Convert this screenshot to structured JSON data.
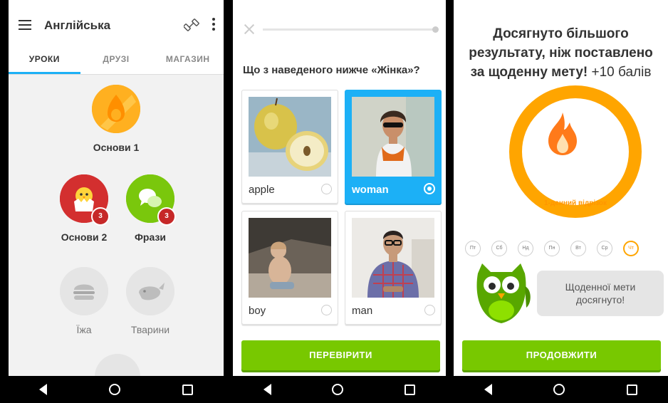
{
  "screen1": {
    "title": "Англійська",
    "tabs": [
      "УРОКИ",
      "ДРУЗІ",
      "МАГАЗИН"
    ],
    "skills": [
      {
        "name": "Основи 1"
      },
      {
        "name": "Основи 2",
        "badge": "3"
      },
      {
        "name": "Фрази",
        "badge": "3"
      },
      {
        "name": "Їжа"
      },
      {
        "name": "Тварини"
      }
    ]
  },
  "screen2": {
    "question": "Що з наведеного нижче «Жінка»?",
    "options": [
      "apple",
      "woman",
      "boy",
      "man"
    ],
    "selected": "woman",
    "check_button": "ПЕРЕВІРИТИ"
  },
  "screen3": {
    "title_line1": "Досягнуто більшого",
    "title_line2": "результату, ніж поставлено",
    "title_line3": "за щоденну мету!",
    "points": "+10 балів",
    "streak_label": "1-денний відрізок",
    "days": [
      "Пт",
      "Сб",
      "Нд",
      "Пн",
      "Вт",
      "Ср",
      "Чт"
    ],
    "owl_message": "Щоденної мети досягнуто!",
    "continue_button": "ПРОДОВЖИТИ"
  },
  "colors": {
    "blue": "#1cb0f6",
    "green": "#78c800",
    "red": "#d32f2f",
    "orange": "#ffa500",
    "nav": "#000000"
  }
}
